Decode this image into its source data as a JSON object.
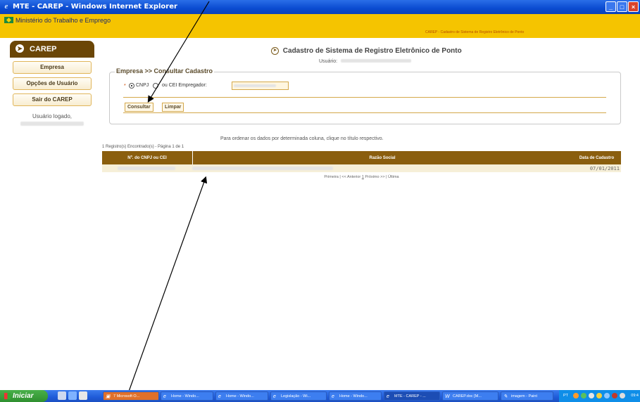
{
  "window": {
    "title": "MTE - CAREP - Windows Internet Explorer"
  },
  "header": {
    "ministry": "Ministério do Trabalho e Emprego",
    "subtitle": "CAREP - Cadastro de Sistema de Registro Eletrônico de Ponto"
  },
  "sidebar": {
    "title": "CAREP",
    "items": [
      {
        "label": "Empresa"
      },
      {
        "label": "Opções de Usuário"
      },
      {
        "label": "Sair do CAREP"
      }
    ],
    "logged_label": "Usuário logado,"
  },
  "main": {
    "page_title": "Cadastro de Sistema de Registro Eletrônico de Ponto",
    "usuario_label": "Usuário:",
    "breadcrumb": "Empresa >> Consultar Cadastro",
    "cnpj_label": "CNPJ",
    "cei_label": "ou CEI Empregador:",
    "consultar_label": "Consultar",
    "limpar_label": "Limpar",
    "order_hint": "Para ordenar os dados por determinada coluna, clique no título respectivo.",
    "records_info": "1 Registro(s) Encontrado(s) - Página 1 de 1",
    "table": {
      "headers": [
        "Nº. do CNPJ ou CEI",
        "Razão Social",
        "Data de Cadastro"
      ],
      "rows": [
        {
          "cnpj": "",
          "razao": "",
          "data": "07/01/2011"
        }
      ]
    },
    "pager": {
      "first": "Primeira",
      "prev": "<< Anterior",
      "page": "1",
      "next": "Próximo >>",
      "last": "Última"
    }
  },
  "taskbar": {
    "start_label": "Iniciar",
    "buttons": [
      {
        "label": "7 Microsoft O..."
      },
      {
        "label": "Home - Windo..."
      },
      {
        "label": "Home - Windo..."
      },
      {
        "label": "Legislação - Wi..."
      },
      {
        "label": "Home - Windo..."
      },
      {
        "label": "MTE - CAREP - ..."
      },
      {
        "label": "CAREP.doc [M..."
      },
      {
        "label": "imagem - Paint"
      }
    ],
    "lang": "PT",
    "time": "09:4"
  }
}
